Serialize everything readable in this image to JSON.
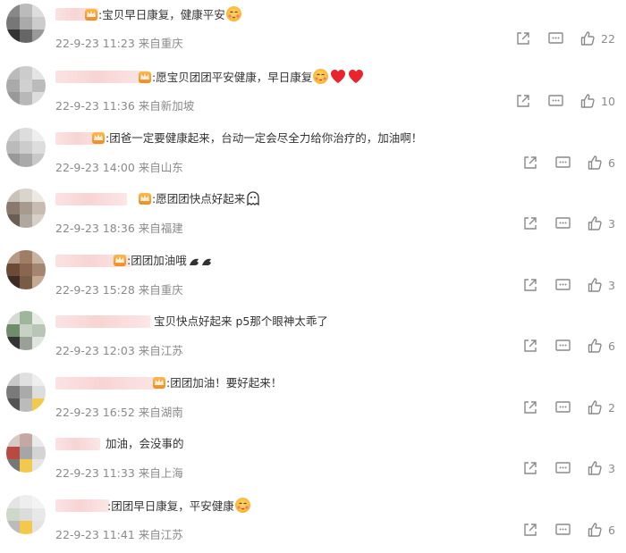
{
  "comments": [
    {
      "text": ":宝贝早日康复，健康平安",
      "date": "22-9-23 11:23",
      "location": "来自重庆",
      "likes": "22",
      "avatar_colors": [
        "#888",
        "#bbb",
        "#ddd",
        "#777",
        "#aaa",
        "#ccc",
        "#333",
        "#666",
        "#999"
      ]
    },
    {
      "text": ":愿宝贝团团平安健康，早日康复",
      "date": "22-9-23 11:36",
      "location": "来自新加坡",
      "likes": "10",
      "avatar_colors": [
        "#bbb",
        "#ccc",
        "#e4e4e4",
        "#aaa",
        "#d0d0d0",
        "#bbb",
        "#999",
        "#b8b8b8",
        "#ddd"
      ]
    },
    {
      "text": ":团爸一定要健康起来，台动一定会尽全力给你治疗的，加油啊！",
      "date": "22-9-23 14:00",
      "location": "来自山东",
      "likes": "6",
      "avatar_colors": [
        "#ccc",
        "#ddd",
        "#eee",
        "#bbb",
        "#ccc",
        "#ddd",
        "#999",
        "#aaa",
        "#c8c8c8"
      ]
    },
    {
      "text": ":愿团团快点好起来",
      "date": "22-9-23 18:36",
      "location": "来自福建",
      "likes": "3",
      "avatar_colors": [
        "#c9c3bb",
        "#d9d4cc",
        "#ece8e2",
        "#8a7a6e",
        "#a79b90",
        "#c6bcb2",
        "#6b5e55",
        "#b0a89f",
        "#d6d0c9"
      ]
    },
    {
      "text": ":团团加油哦",
      "date": "22-9-23 15:28",
      "location": "来自重庆",
      "likes": "3",
      "avatar_colors": [
        "#b49a86",
        "#a07e66",
        "#c8b2a0",
        "#6b4a36",
        "#8a6650",
        "#a48570",
        "#3e2c22",
        "#7a5b48",
        "#c4a994"
      ]
    },
    {
      "text": "宝贝快点好起来  p5那个眼神太乖了",
      "date": "22-9-23 12:03",
      "location": "来自江苏",
      "likes": "6",
      "avatar_colors": [
        "#d6dbd4",
        "#9fb59c",
        "#e6ebe4",
        "#6f8c6b",
        "#c8d2c4",
        "#b9c6b6",
        "#333",
        "#9aa098",
        "#e0e4de"
      ]
    },
    {
      "text": ":团团加油！要好起来！",
      "date": "22-9-23 16:52",
      "location": "来自湖南",
      "likes": "2",
      "avatar_colors": [
        "#c8c8c8",
        "#e0e0e0",
        "#eee",
        "#7a7a7a",
        "#aaa",
        "#ddd",
        "#555",
        "#bbb",
        "#f2c94c"
      ]
    },
    {
      "text": "加油，会没事的",
      "date": "22-9-23 11:33",
      "location": "来自上海",
      "likes": "3",
      "avatar_colors": [
        "#d8c8c6",
        "#c4a8a4",
        "#eaeaea",
        "#b84a44",
        "#a6a6a6",
        "#d4d4d4",
        "#777",
        "#f2c94c",
        "#e5e5e5"
      ]
    },
    {
      "text": ":团团早日康复，平安健康",
      "date": "22-9-23 11:41",
      "location": "来自江苏",
      "likes": "6",
      "avatar_colors": [
        "#e4e4e4",
        "#eee",
        "#f3f3f3",
        "#ccd8c8",
        "#dcdcdc",
        "#e8e8e8",
        "#bbb",
        "#f2c94c",
        "#e4e4e4"
      ]
    }
  ],
  "icons": {
    "share": "share-icon",
    "comment": "comment-icon",
    "like": "like-icon"
  },
  "colors": {
    "meta_text": "#8a8a8a",
    "heart": "#e8242d",
    "emoji": "#f7b733"
  }
}
